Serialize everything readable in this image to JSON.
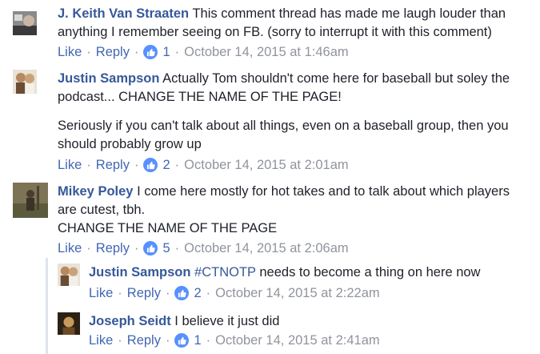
{
  "actions": {
    "like": "Like",
    "reply": "Reply",
    "separator": "·"
  },
  "comments": [
    {
      "author": "J. Keith Van Straaten",
      "lines": [
        "This comment thread has made me laugh louder than",
        "anything I remember seeing on FB. (sorry to interrupt it with this comment)"
      ],
      "like_count": "1",
      "timestamp": "October 14, 2015 at 1:46am"
    },
    {
      "author": "Justin Sampson",
      "lines": [
        "Actually Tom shouldn't come here for baseball but soley the",
        "podcast... CHANGE THE NAME OF THE PAGE!"
      ],
      "paragraph2": [
        "Seriously if you can't talk about all things, even on a baseball group, then you",
        "should probably grow up"
      ],
      "like_count": "2",
      "timestamp": "October 14, 2015 at 2:01am"
    },
    {
      "author": "Mikey Poley",
      "lines": [
        "I come here mostly for hot takes and to talk about which players",
        "are cutest, tbh.",
        "CHANGE THE NAME OF THE PAGE"
      ],
      "like_count": "5",
      "timestamp": "October 14, 2015 at 2:06am"
    }
  ],
  "replies": [
    {
      "author": "Justin Sampson",
      "hashtag": "#CTNOTP",
      "text": "needs to become a thing on here now",
      "like_count": "2",
      "timestamp": "October 14, 2015 at 2:22am"
    },
    {
      "author": "Joseph Seidt",
      "text": "I believe it just did",
      "like_count": "1",
      "timestamp": "October 14, 2015 at 2:41am"
    }
  ],
  "colors": {
    "link": "#365899",
    "meta": "#90949c",
    "like_badge": "#5890ff",
    "thread_rule": "#dfe3ee"
  }
}
